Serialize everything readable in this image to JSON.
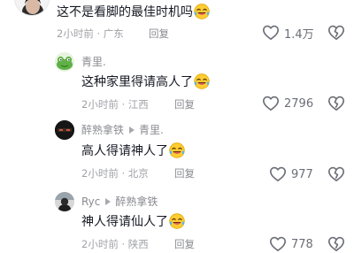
{
  "comments": [
    {
      "author": "",
      "text": "这不是看脚的最佳时机吗",
      "time": "2小时前",
      "location": "广东",
      "reply_label": "回复",
      "likes": "1.4万",
      "emoji": "laughing-crying-emoji"
    },
    {
      "author": "青里.",
      "reply_to": "",
      "text": "这种家里得请高人了",
      "time": "2小时前",
      "location": "江西",
      "reply_label": "回复",
      "likes": "2796",
      "emoji": "laughing-crying-emoji"
    },
    {
      "author": "醉熟拿铁",
      "reply_to": "青里.",
      "text": "高人得请神人了",
      "time": "2小时前",
      "location": "北京",
      "reply_label": "回复",
      "likes": "977",
      "emoji": "laughing-crying-emoji"
    },
    {
      "author": "Ryc",
      "reply_to": "醉熟拿铁",
      "text": "神人得请仙人了",
      "time": "2小时前",
      "location": "陕西",
      "reply_label": "回复",
      "likes": "778",
      "emoji": "laughing-crying-emoji"
    }
  ],
  "meta_separator": "·",
  "icons": {
    "like": "heart-outline-icon",
    "dislike": "broken-heart-icon"
  },
  "colors": {
    "text": "#161823",
    "secondary": "#8a8b91",
    "icon": "#6c6e77"
  }
}
